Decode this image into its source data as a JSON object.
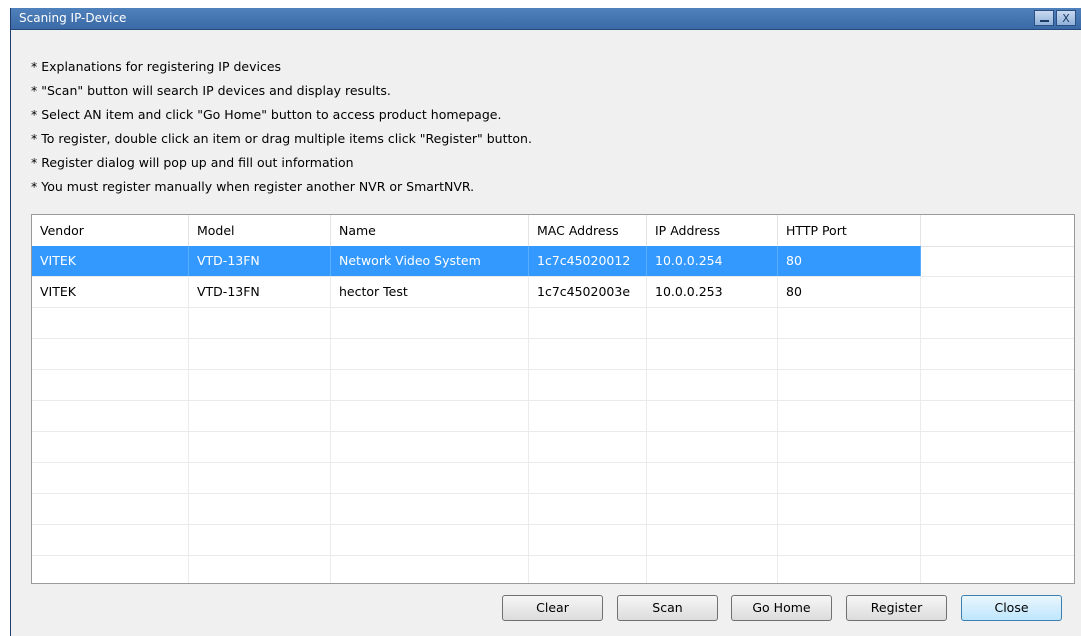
{
  "window": {
    "title": "Scaning IP-Device",
    "minimize_icon": "minimize-icon",
    "close_glyph": "X"
  },
  "explanations": [
    "* Explanations for registering IP devices",
    "* \"Scan\" button will search IP devices and display results.",
    "* Select AN item and click \"Go Home\" button to access product homepage.",
    "* To register, double click an item or drag multiple items click \"Register\" button.",
    "* Register dialog will pop up and fill out information",
    "* You must register manually when register another NVR or SmartNVR."
  ],
  "table": {
    "columns": [
      "Vendor",
      "Model",
      "Name",
      "MAC Address",
      "IP Address",
      "HTTP Port"
    ],
    "rows": [
      {
        "vendor": "VITEK",
        "model": "VTD-13FN",
        "name": "Network Video System",
        "mac": "1c7c45020012",
        "ip": "10.0.0.254",
        "port": "80"
      },
      {
        "vendor": "VITEK",
        "model": "VTD-13FN",
        "name": "hector Test",
        "mac": "1c7c4502003e",
        "ip": "10.0.0.253",
        "port": "80"
      }
    ],
    "selected_row": 0,
    "selection_color": "#3399ff"
  },
  "buttons": {
    "clear": "Clear",
    "scan": "Scan",
    "go_home": "Go Home",
    "register": "Register",
    "close": "Close"
  },
  "colors": {
    "titlebar": "#4f81bd",
    "background": "#f0f0f0"
  }
}
